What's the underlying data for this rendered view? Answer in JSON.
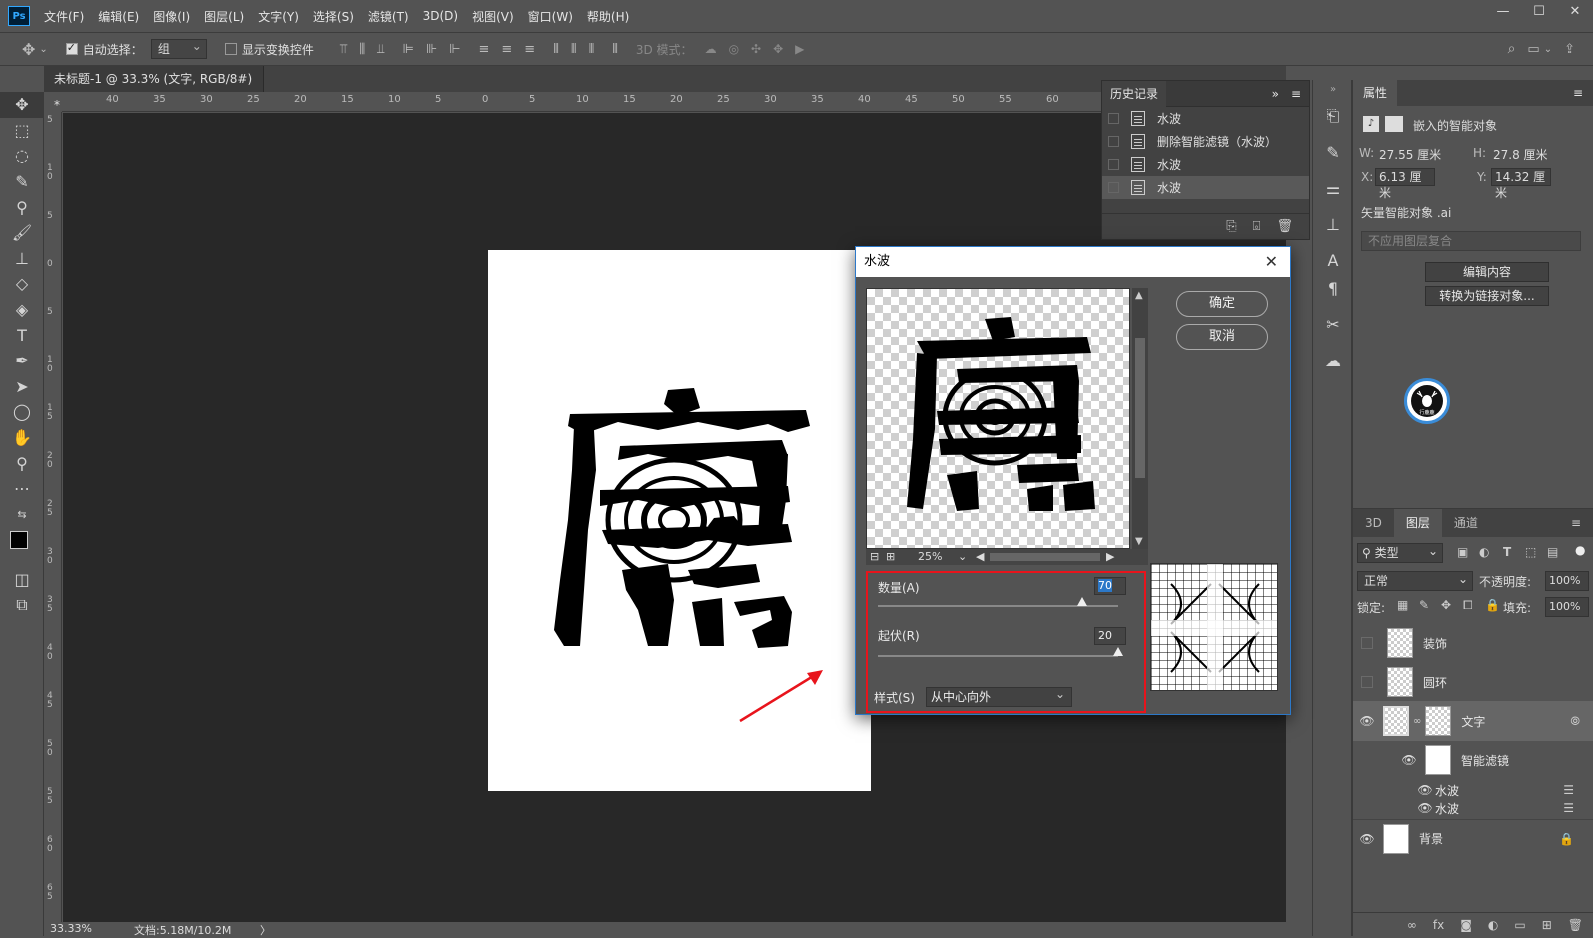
{
  "app": {
    "logo": "Ps"
  },
  "menu": [
    "文件(F)",
    "编辑(E)",
    "图像(I)",
    "图层(L)",
    "文字(Y)",
    "选择(S)",
    "滤镜(T)",
    "3D(D)",
    "视图(V)",
    "窗口(W)",
    "帮助(H)"
  ],
  "options": {
    "auto_select_label": "自动选择：",
    "auto_select_value": "组",
    "show_transform_label": "显示变换控件",
    "mode_3d_label": "3D 模式："
  },
  "document_tab": {
    "title": "未标题-1 @ 33.3% (文字, RGB/8#) *",
    "close": "×"
  },
  "ruler_top": [
    "40",
    "35",
    "30",
    "25",
    "20",
    "15",
    "10",
    "5",
    "0",
    "5",
    "10",
    "15",
    "20",
    "25",
    "30",
    "35",
    "40",
    "45",
    "50",
    "55",
    "60"
  ],
  "ruler_left": [
    "5",
    "1 0",
    "5",
    "0",
    "5",
    "1 0",
    "1 5",
    "2 0",
    "2 5",
    "3 0",
    "3 5",
    "4 0",
    "4 5",
    "5 0",
    "5 5",
    "6 0",
    "6 5"
  ],
  "status": {
    "zoom": "33.33%",
    "doc": "文档:5.18M/10.2M",
    "arrow": "〉"
  },
  "history": {
    "title": "历史记录",
    "expand": "»",
    "menu": "≡",
    "items": [
      {
        "label": "水波",
        "selected": false
      },
      {
        "label": "删除智能滤镜（水波）",
        "selected": false
      },
      {
        "label": "水波",
        "selected": false
      },
      {
        "label": "水波",
        "selected": true
      }
    ]
  },
  "properties": {
    "title": "属性",
    "menu": "≡",
    "type_label": "嵌入的智能对象",
    "w_label": "W:",
    "w_value": "27.55 厘米",
    "h_label": "H:",
    "h_value": "27.8 厘米",
    "x_label": "X:",
    "x_value": "6.13 厘米",
    "y_label": "Y:",
    "y_value": "14.32 厘米",
    "source": "矢量智能对象 .ai",
    "comp_placeholder": "不应用图层复合",
    "edit_button": "编辑内容",
    "convert_button": "转换为链接对象..."
  },
  "layers": {
    "tabs": [
      "3D",
      "图层",
      "通道"
    ],
    "active_tab": "图层",
    "filter_kind": "类型",
    "blend_mode": "正常",
    "opacity_label": "不透明度:",
    "opacity_value": "100%",
    "lock_label": "锁定:",
    "fill_label": "填充:",
    "fill_value": "100%",
    "items": [
      {
        "name": "装饰",
        "visible": false
      },
      {
        "name": "圆环",
        "visible": false
      },
      {
        "name": "文字",
        "visible": true,
        "selected": true
      },
      {
        "name": "智能滤镜",
        "sub": true
      },
      {
        "name": "水波",
        "filter": true
      },
      {
        "name": "水波",
        "filter": true
      },
      {
        "name": "背景",
        "visible": true,
        "locked": true
      }
    ]
  },
  "dialog": {
    "title": "水波",
    "close": "✕",
    "ok": "确定",
    "cancel": "取消",
    "zoom": "25%",
    "amount_label": "数量(A)",
    "amount_value": "70",
    "ridges_label": "起伏(R)",
    "ridges_value": "20",
    "style_label": "样式(S)",
    "style_value": "从中心向外",
    "amount_fraction": 0.85,
    "ridges_fraction": 1.0
  },
  "badge": {
    "text": "行鹿鹿"
  },
  "colors": {
    "accent": "#2c78c8",
    "highlight": "#e8141c",
    "arrow": "#e8141c"
  }
}
